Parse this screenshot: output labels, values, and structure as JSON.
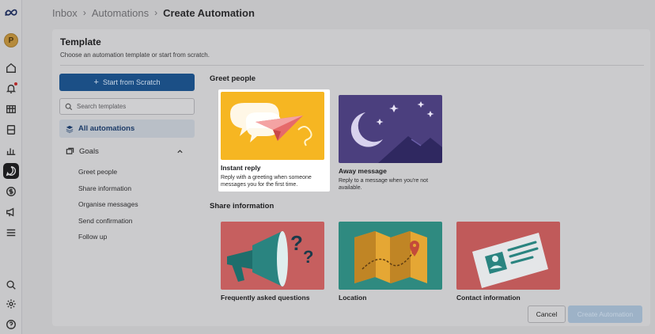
{
  "breadcrumb": {
    "items": [
      "Inbox",
      "Automations"
    ],
    "current": "Create Automation"
  },
  "user": {
    "avatar_initial": "P"
  },
  "template": {
    "title": "Template",
    "subtitle": "Choose an automation template or start from scratch.",
    "start_button": "Start from Scratch",
    "search_placeholder": "Search templates",
    "all_automations": "All automations",
    "goals_label": "Goals",
    "goals": [
      "Greet people",
      "Share information",
      "Organise messages",
      "Send confirmation",
      "Follow up"
    ]
  },
  "sections": {
    "greet": {
      "title": "Greet people",
      "cards": [
        {
          "title": "Instant reply",
          "desc": "Reply with a greeting when someone messages you for the first time."
        },
        {
          "title": "Away message",
          "desc": "Reply to a message when you're not available."
        }
      ]
    },
    "share": {
      "title": "Share information",
      "cards": [
        {
          "title": "Frequently asked questions"
        },
        {
          "title": "Location"
        },
        {
          "title": "Contact information"
        }
      ]
    }
  },
  "footer": {
    "cancel": "Cancel",
    "create": "Create Automation"
  },
  "colors": {
    "primary": "#1b4f86",
    "highlight_card": "#ffffff",
    "instant_reply_bg": "#f6b622"
  }
}
